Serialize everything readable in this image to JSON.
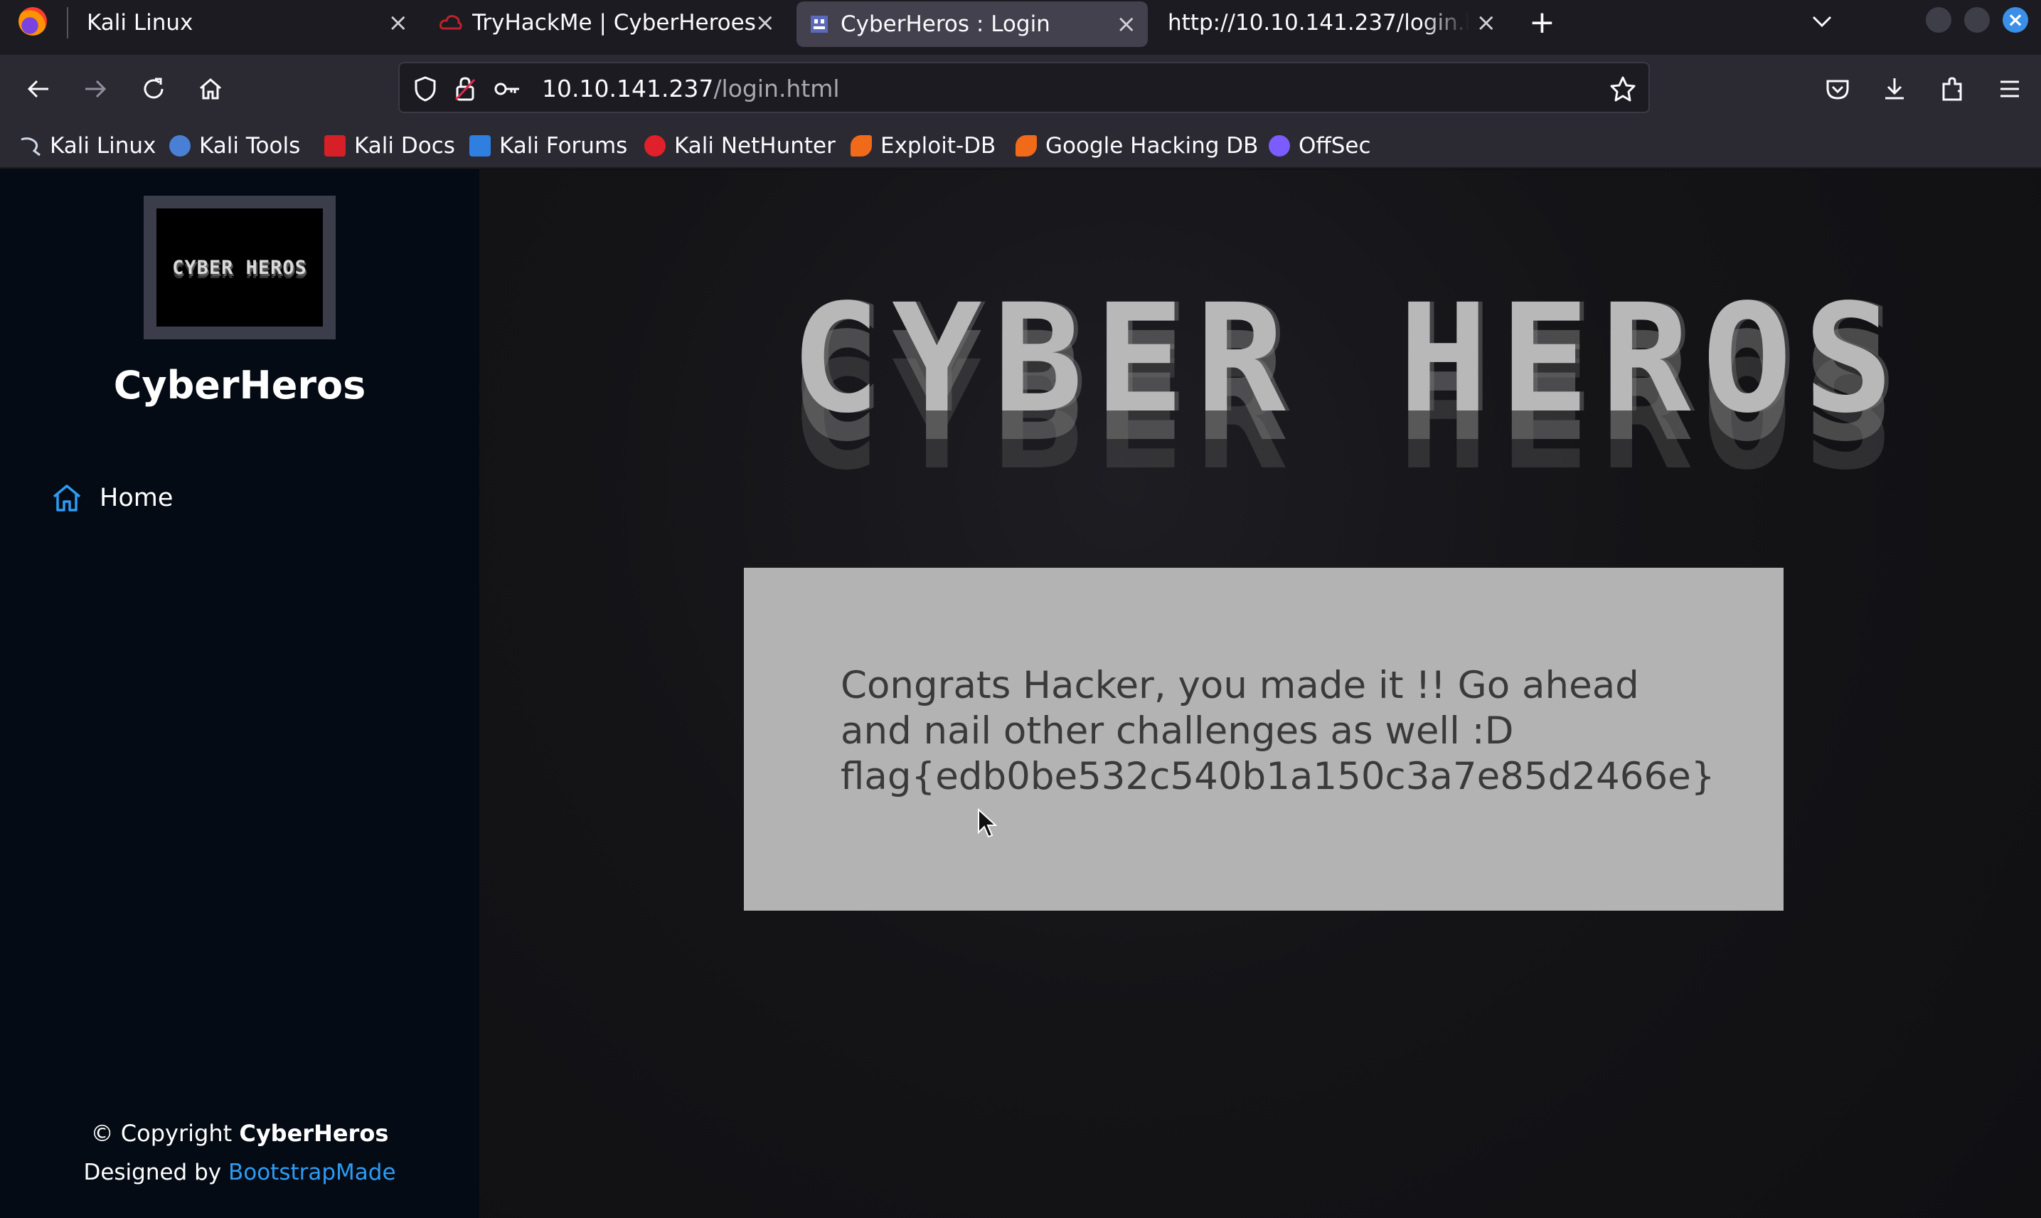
{
  "browser": {
    "tabs": [
      {
        "label": "Kali Linux",
        "active": false
      },
      {
        "label": "TryHackMe | CyberHeroes",
        "active": false
      },
      {
        "label": "CyberHeros : Login",
        "active": true
      },
      {
        "label": "http://10.10.141.237/login.htm",
        "active": false
      }
    ],
    "url": {
      "host": "10.10.141.237",
      "path": "/login.html"
    },
    "bookmarks": [
      {
        "label": "Kali Linux",
        "color": "#3b6ea8"
      },
      {
        "label": "Kali Tools",
        "color": "#4a7fd6"
      },
      {
        "label": "Kali Docs",
        "color": "#d61f26"
      },
      {
        "label": "Kali Forums",
        "color": "#2f7fe0"
      },
      {
        "label": "Kali NetHunter",
        "color": "#e0202a"
      },
      {
        "label": "Exploit-DB",
        "color": "#f06a1a"
      },
      {
        "label": "Google Hacking DB",
        "color": "#f06a1a"
      },
      {
        "label": "OffSec",
        "color": "#7a5cff"
      }
    ]
  },
  "sidebar": {
    "logo_text": "CYBER HEROS",
    "site_name": "CyberHeros",
    "nav": [
      {
        "label": "Home"
      }
    ],
    "footer": {
      "copyright_prefix": "© Copyright ",
      "copyright_name": "CyberHeros",
      "designed_prefix": "Designed by ",
      "designed_link": "BootstrapMade"
    }
  },
  "main": {
    "banner_text": "CYBER HEROS",
    "message_line1": "Congrats Hacker, you made it !! Go ahead and nail other challenges as well :D",
    "message_flag": "flag{edb0be532c540b1a150c3a7e85d2466e}"
  },
  "colors": {
    "sidebar_bg": "#040b14",
    "link_blue": "#2d9cf5",
    "message_box": "#b3b3b3"
  }
}
